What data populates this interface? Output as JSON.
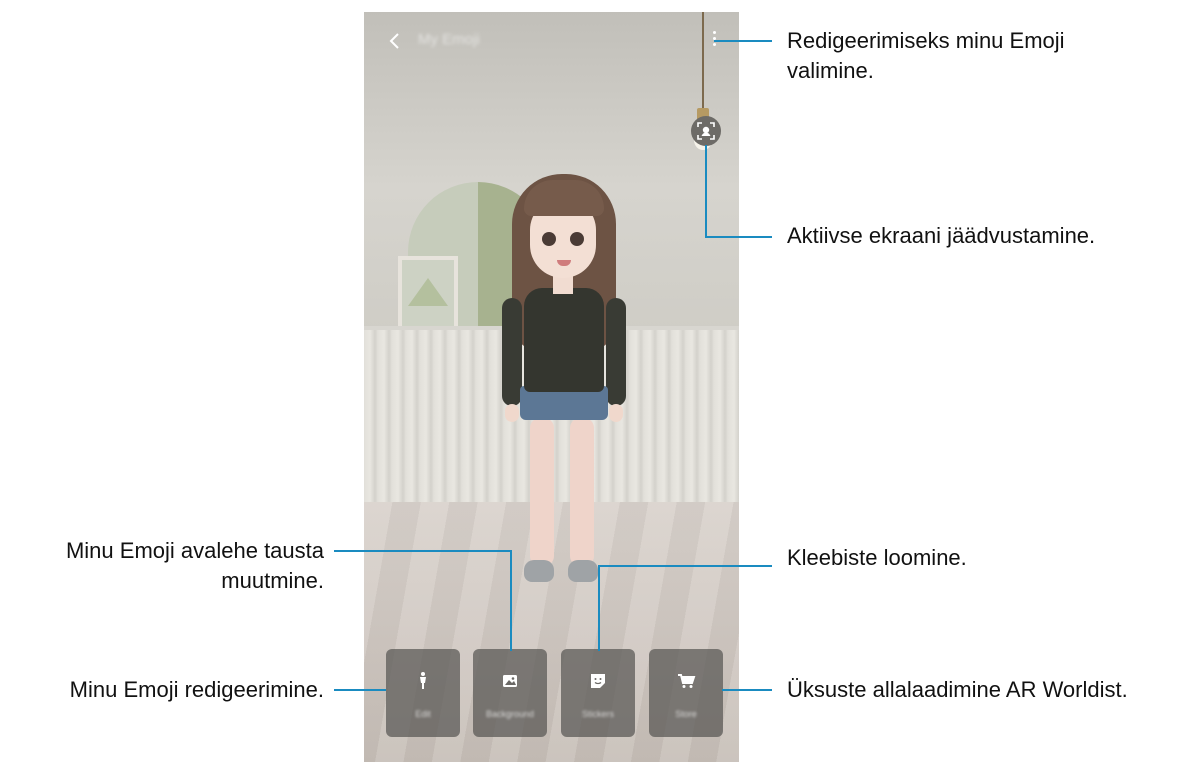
{
  "screen": {
    "title": "My Emoji",
    "back_icon": "back-chevron-icon",
    "more_icon": "more-options-icon",
    "capture_icon": "face-capture-icon"
  },
  "bottom_buttons": [
    {
      "label": "Edit",
      "icon": "person-icon"
    },
    {
      "label": "Background",
      "icon": "image-icon"
    },
    {
      "label": "Stickers",
      "icon": "sticker-icon"
    },
    {
      "label": "Store",
      "icon": "cart-icon"
    }
  ],
  "callouts": {
    "more_options_line1": "Redigeerimiseks minu Emoji",
    "more_options_line2": "valimine.",
    "capture": "Aktiivse ekraani jäädvustamine.",
    "stickers": "Kleebiste loomine.",
    "store": "Üksuste allalaadimine AR Worldist.",
    "background_line1": "Minu Emoji avalehe tausta",
    "background_line2": "muutmine.",
    "edit": "Minu Emoji redigeerimine."
  },
  "colors": {
    "callout_line": "#1a8bc0"
  }
}
